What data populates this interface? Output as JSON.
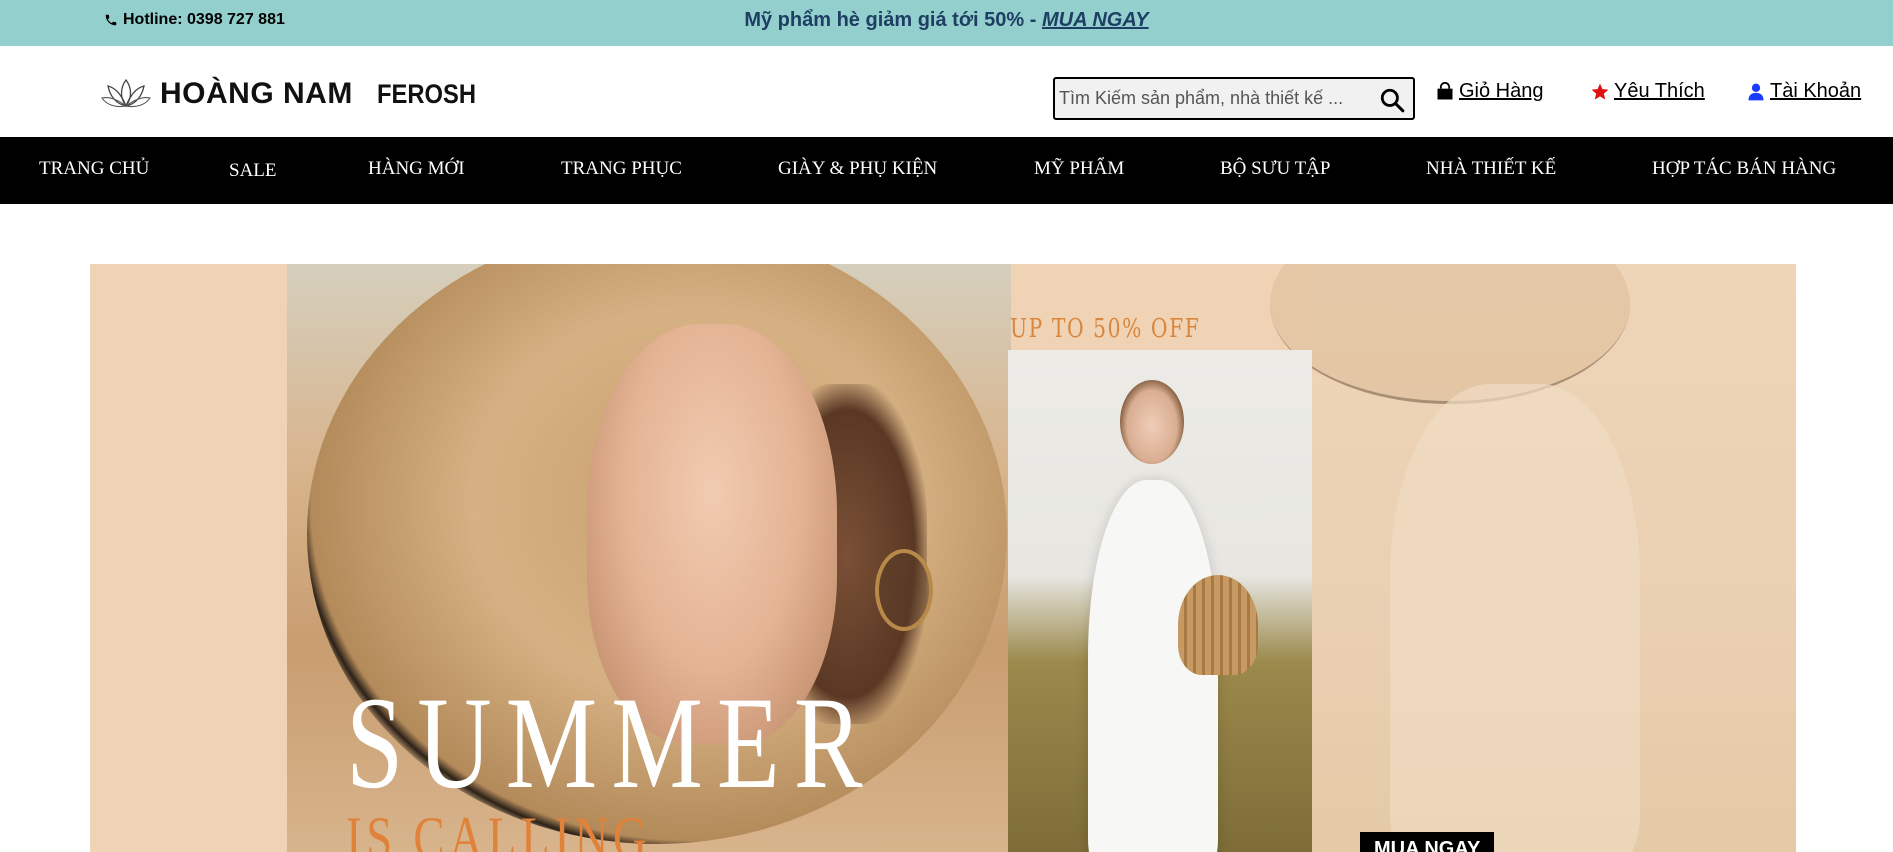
{
  "topbar": {
    "hotline": "Hotline: 0398 727 881",
    "promo_text": "Mỹ phẩm hè giảm giá tới 50% - ",
    "promo_link": "MUA NGAY"
  },
  "header": {
    "brand": "HOÀNG NAM",
    "sub_brand": "FEROSH",
    "search_placeholder": "Tìm Kiếm sản phẩm, nhà thiết kế ...",
    "links": {
      "cart": "Giỏ Hàng",
      "favorites": "Yêu Thích",
      "account": "Tài Khoản"
    }
  },
  "nav": {
    "items": [
      "TRANG CHỦ",
      "SALE",
      "HÀNG MỚI",
      "TRANG PHỤC",
      "GIÀY & PHỤ KIỆN",
      "MỸ PHẨM",
      "BỘ SƯU TẬP",
      "NHÀ THIẾT KẾ",
      "HỢP TÁC BÁN HÀNG"
    ]
  },
  "banner": {
    "promo": "UP TO 50% OFF",
    "headline": "SUMMER",
    "subheadline": "IS CALLING",
    "cta": "MUA NGAY"
  },
  "colors": {
    "topbar_bg": "#93d0cd",
    "promo_text": "#1f3e63",
    "nav_bg": "#000000",
    "banner_bg": "#f0d3b5",
    "banner_accent": "#e0823a",
    "favorite_icon": "#e01010",
    "account_icon": "#1a3cff"
  },
  "icons": {
    "hotline": "phone-icon",
    "search": "search-icon",
    "cart": "shopping-bag-icon",
    "favorites": "star-icon",
    "account": "user-icon",
    "logo": "lotus-icon"
  }
}
